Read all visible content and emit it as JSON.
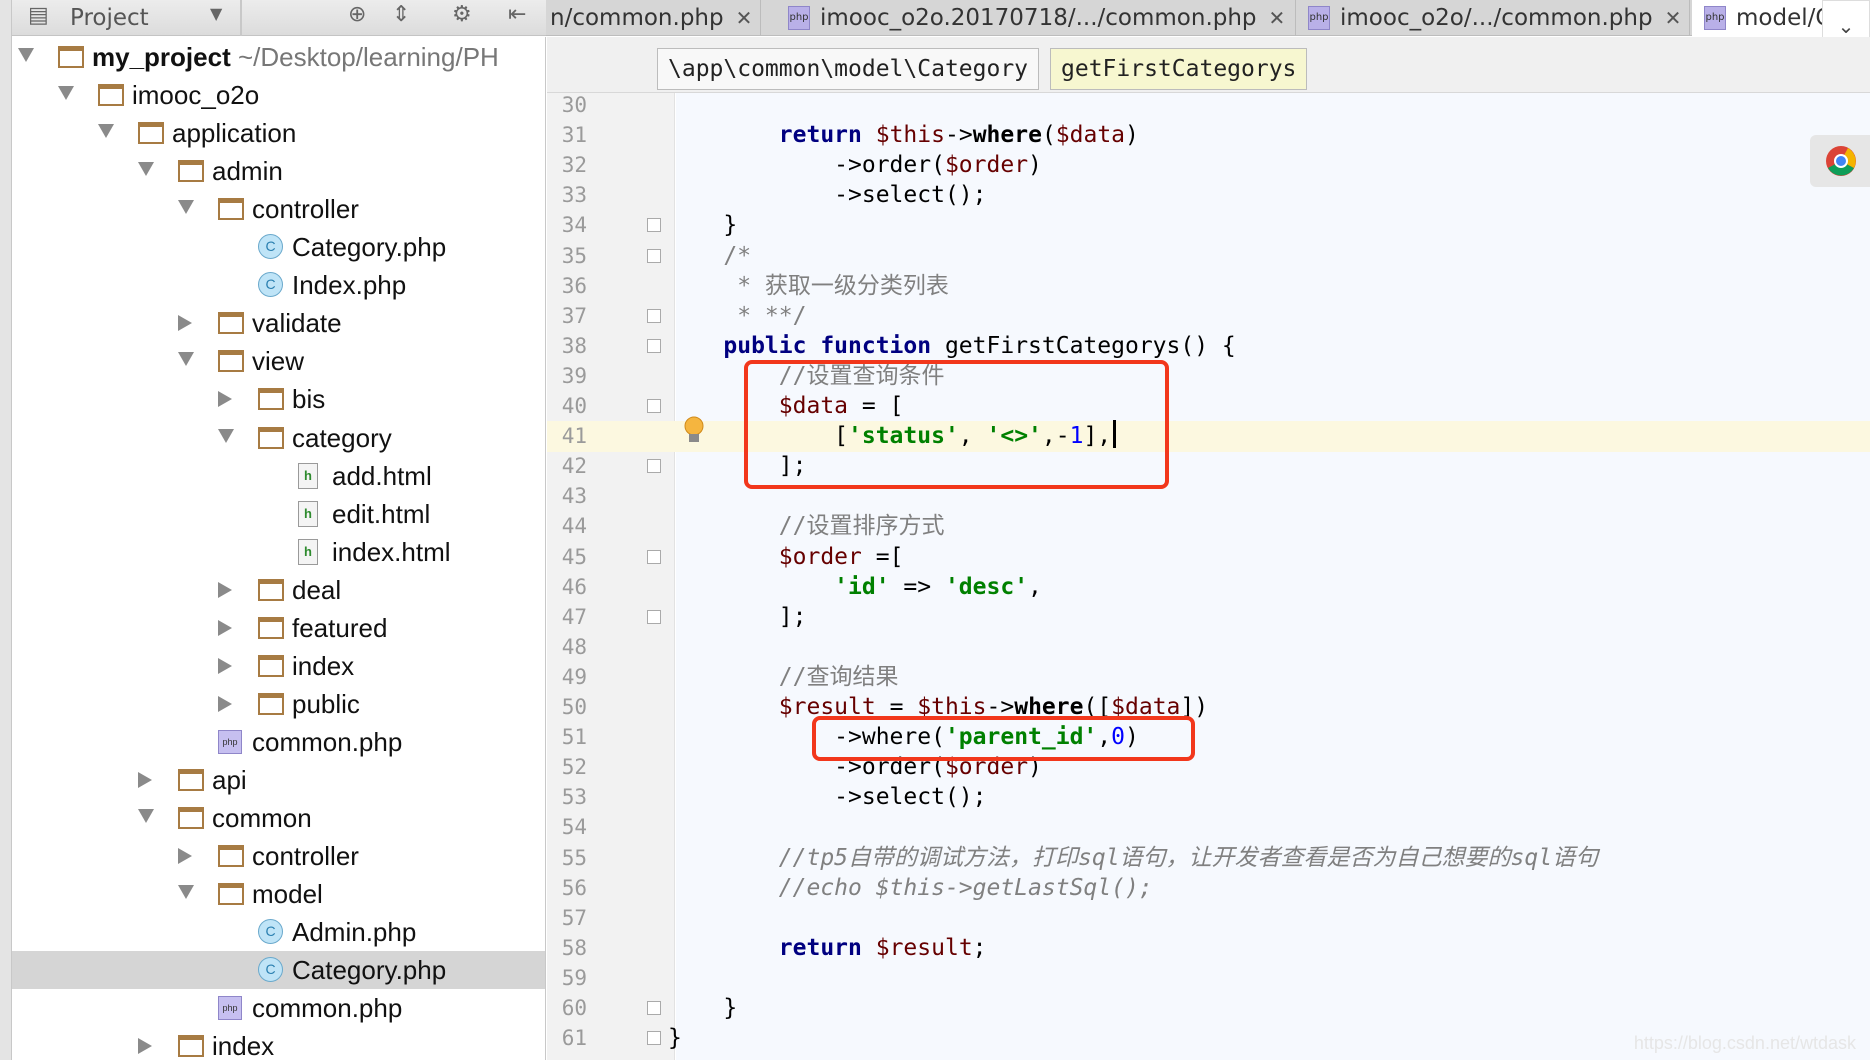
{
  "project_pane": {
    "title": "Project",
    "dropdown_icon": "caret-down-icon",
    "icons": [
      "locate-icon",
      "collapse-icon",
      "gear-icon",
      "hide-icon"
    ]
  },
  "tabs": [
    {
      "label": "n/common.php",
      "icon": "php-file-icon",
      "active": false
    },
    {
      "label": "imooc_o2o.20170718/.../common.php",
      "icon": "php-file-icon",
      "active": false
    },
    {
      "label": "imooc_o2o/.../common.php",
      "icon": "php-file-icon",
      "active": false
    },
    {
      "label": "model/Cate",
      "icon": "php-file-icon",
      "active": true
    }
  ],
  "php_icon_text": "php",
  "breadcrumb": {
    "namespace": "\\app\\common\\model\\Category",
    "method": "getFirstCategorys"
  },
  "tree": [
    {
      "level": 0,
      "arrow": "open",
      "type": "folder",
      "label": "my_project",
      "bold": true,
      "extra": " ~/Desktop/learning/PH"
    },
    {
      "level": 1,
      "arrow": "open",
      "type": "folder",
      "label": "imooc_o2o"
    },
    {
      "level": 2,
      "arrow": "open",
      "type": "folder",
      "label": "application"
    },
    {
      "level": 3,
      "arrow": "open",
      "type": "folder",
      "label": "admin"
    },
    {
      "level": 4,
      "arrow": "open",
      "type": "folder",
      "label": "controller"
    },
    {
      "level": 5,
      "arrow": "none",
      "type": "class",
      "label": "Category.php"
    },
    {
      "level": 5,
      "arrow": "none",
      "type": "class",
      "label": "Index.php"
    },
    {
      "level": 4,
      "arrow": "closed",
      "type": "folder",
      "label": "validate"
    },
    {
      "level": 4,
      "arrow": "open",
      "type": "folder",
      "label": "view"
    },
    {
      "level": 5,
      "arrow": "closed",
      "type": "folder",
      "label": "bis"
    },
    {
      "level": 5,
      "arrow": "open",
      "type": "folder",
      "label": "category"
    },
    {
      "level": 6,
      "arrow": "none",
      "type": "html",
      "label": "add.html"
    },
    {
      "level": 6,
      "arrow": "none",
      "type": "html",
      "label": "edit.html"
    },
    {
      "level": 6,
      "arrow": "none",
      "type": "html",
      "label": "index.html"
    },
    {
      "level": 5,
      "arrow": "closed",
      "type": "folder",
      "label": "deal"
    },
    {
      "level": 5,
      "arrow": "closed",
      "type": "folder",
      "label": "featured"
    },
    {
      "level": 5,
      "arrow": "closed",
      "type": "folder",
      "label": "index"
    },
    {
      "level": 5,
      "arrow": "closed",
      "type": "folder",
      "label": "public"
    },
    {
      "level": 4,
      "arrow": "none",
      "type": "php",
      "label": "common.php"
    },
    {
      "level": 3,
      "arrow": "closed",
      "type": "folder",
      "label": "api"
    },
    {
      "level": 3,
      "arrow": "open",
      "type": "folder",
      "label": "common"
    },
    {
      "level": 4,
      "arrow": "closed",
      "type": "folder",
      "label": "controller"
    },
    {
      "level": 4,
      "arrow": "open",
      "type": "folder",
      "label": "model"
    },
    {
      "level": 5,
      "arrow": "none",
      "type": "class",
      "label": "Admin.php"
    },
    {
      "level": 5,
      "arrow": "none",
      "type": "class",
      "label": "Category.php",
      "selected": true
    },
    {
      "level": 4,
      "arrow": "none",
      "type": "php",
      "label": "common.php"
    },
    {
      "level": 3,
      "arrow": "closed",
      "type": "folder",
      "label": "index"
    }
  ],
  "editor": {
    "first_line": 30,
    "current_line": 41,
    "lines": [
      [],
      [
        [
          "",
          "        "
        ],
        [
          "kw",
          "return"
        ],
        [
          "",
          " "
        ],
        [
          "var",
          "$this"
        ],
        [
          "",
          "->"
        ],
        [
          "mb",
          "where"
        ],
        [
          "",
          "("
        ],
        [
          "var",
          "$data"
        ],
        [
          "",
          ")"
        ]
      ],
      [
        [
          "",
          "            ->order("
        ],
        [
          "var",
          "$order"
        ],
        [
          "",
          ")"
        ]
      ],
      [
        [
          "",
          "            ->select();"
        ]
      ],
      [
        [
          "",
          "    }"
        ]
      ],
      [
        [
          "cm",
          "    /*"
        ]
      ],
      [
        [
          "cm",
          "     * 获取一级分类列表"
        ]
      ],
      [
        [
          "cm",
          "     * **/"
        ]
      ],
      [
        [
          "",
          "    "
        ],
        [
          "kw",
          "public function"
        ],
        [
          "",
          " getFirstCategorys() {"
        ]
      ],
      [
        [
          "cm",
          "        //设置查询条件"
        ]
      ],
      [
        [
          "",
          "        "
        ],
        [
          "var",
          "$data"
        ],
        [
          "",
          " = ["
        ]
      ],
      [
        [
          "",
          "            ["
        ],
        [
          "str",
          "'status'"
        ],
        [
          "",
          ", "
        ],
        [
          "str",
          "'<>'"
        ],
        [
          "",
          ",-"
        ],
        [
          "num",
          "1"
        ],
        [
          "",
          "],"
        ]
      ],
      [
        [
          "",
          "        ];"
        ]
      ],
      [],
      [
        [
          "cm",
          "        //设置排序方式"
        ]
      ],
      [
        [
          "",
          "        "
        ],
        [
          "var",
          "$order"
        ],
        [
          "",
          " =["
        ]
      ],
      [
        [
          "",
          "            "
        ],
        [
          "str",
          "'id'"
        ],
        [
          "",
          " => "
        ],
        [
          "str",
          "'desc'"
        ],
        [
          "",
          ","
        ]
      ],
      [
        [
          "",
          "        ];"
        ]
      ],
      [],
      [
        [
          "cm",
          "        //查询结果"
        ]
      ],
      [
        [
          "",
          "        "
        ],
        [
          "var",
          "$result"
        ],
        [
          "",
          " = "
        ],
        [
          "var",
          "$this"
        ],
        [
          "",
          "->"
        ],
        [
          "mb",
          "where"
        ],
        [
          "",
          "(["
        ],
        [
          "var",
          "$data"
        ],
        [
          "",
          "])"
        ]
      ],
      [
        [
          "",
          "            ->where("
        ],
        [
          "str",
          "'parent_id'"
        ],
        [
          "",
          ","
        ],
        [
          "num",
          "0"
        ],
        [
          "",
          ")"
        ]
      ],
      [
        [
          "",
          "            ->order("
        ],
        [
          "var",
          "$order"
        ],
        [
          "",
          ")"
        ]
      ],
      [
        [
          "",
          "            ->select();"
        ]
      ],
      [],
      [
        [
          "cmi",
          "        //tp5自带的调试方法，打印sql语句，让开发者查看是否为自己想要的sql语句"
        ]
      ],
      [
        [
          "cmi",
          "        //echo $this->getLastSql();"
        ]
      ],
      [],
      [
        [
          "",
          "        "
        ],
        [
          "kw",
          "return"
        ],
        [
          "",
          " "
        ],
        [
          "var",
          "$result"
        ],
        [
          "",
          ";"
        ]
      ],
      [],
      [
        [
          "",
          "    }"
        ]
      ],
      [
        [
          "",
          "}"
        ]
      ]
    ],
    "fold_markers": [
      34,
      35,
      37,
      38,
      40,
      42,
      45,
      47,
      60,
      61
    ],
    "highlight_color": "#f2371c"
  },
  "watermark": "https://blog.csdn.net/wtdask"
}
